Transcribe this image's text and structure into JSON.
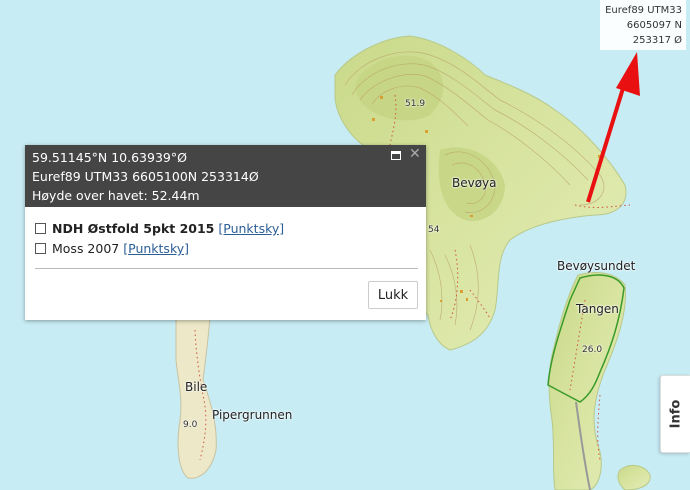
{
  "coordinate_readout": {
    "line1": "Euref89 UTM33",
    "line2": "6605097 N",
    "line3": "253317 Ø"
  },
  "popup": {
    "latlon": "59.51145°N 10.63939°Ø",
    "utm": "Euref89 UTM33 6605100N 253314Ø",
    "elevation": "Høyde over havet: 52.44m",
    "layers": [
      {
        "name": "NDH Østfold 5pkt 2015",
        "link": "[Punktsky]",
        "bold": true,
        "checked": false
      },
      {
        "name": "Moss 2007",
        "link": "[Punktsky]",
        "bold": false,
        "checked": false
      }
    ],
    "close_label": "Lukk",
    "partial_number": "54"
  },
  "map_labels": {
    "bevoya": "Bevøya",
    "bevoysundet": "Bevøysundet",
    "tangen": "Tangen",
    "bile": "Bile",
    "pipergrunnen": "Pipergrunnen",
    "elev_1": "51.9",
    "elev_2": "26.0",
    "elev_3": "9.0"
  },
  "info_tab": {
    "label": "Info"
  },
  "colors": {
    "water": "#c8ecf4",
    "land": "#dbe7a6",
    "terrain_high": "#c7d887",
    "contour": "#b9a36a",
    "sand": "#ece8c8",
    "popup_header": "#454545",
    "arrow": "#e81010",
    "boundary": "#3a9a2a"
  }
}
